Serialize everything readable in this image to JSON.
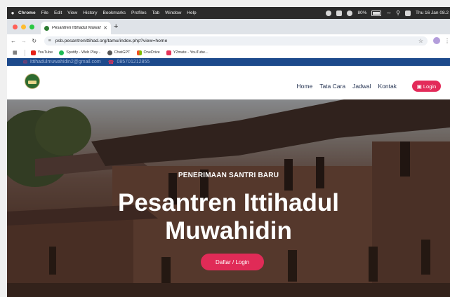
{
  "mac": {
    "app": "Chrome",
    "menus": [
      "File",
      "Edit",
      "View",
      "History",
      "Bookmarks",
      "Profiles",
      "Tab",
      "Window",
      "Help"
    ],
    "battery": "80%",
    "clock": "Thu 16 Jan 08.2"
  },
  "browser": {
    "tab_title": "Pesantren Ittihadul Muwahidin",
    "url": "psb.pesantrenittihad.org/tamu/index.php?view=home",
    "bookmarks": [
      "YouTube",
      "Spotify - Web Play...",
      "ChatGPT",
      "OneDrive",
      "Y2mate - YouTube..."
    ]
  },
  "site": {
    "email": "Ittihadulmuwahidin2@gmail.com",
    "phone": "085701212855",
    "nav": [
      "Home",
      "Tata Cara",
      "Jadwal",
      "Kontak"
    ],
    "login_label": "Login",
    "hero_kicker": "PENERIMAAN SANTRI BARU",
    "hero_title_line1": "Pesantren Ittihadul",
    "hero_title_line2": "Muwahidin",
    "cta_label": "Daftar / Login"
  },
  "colors": {
    "accent": "#e32b5a",
    "topbar": "#1d4a8c",
    "nav_text": "#1e2d4d"
  }
}
